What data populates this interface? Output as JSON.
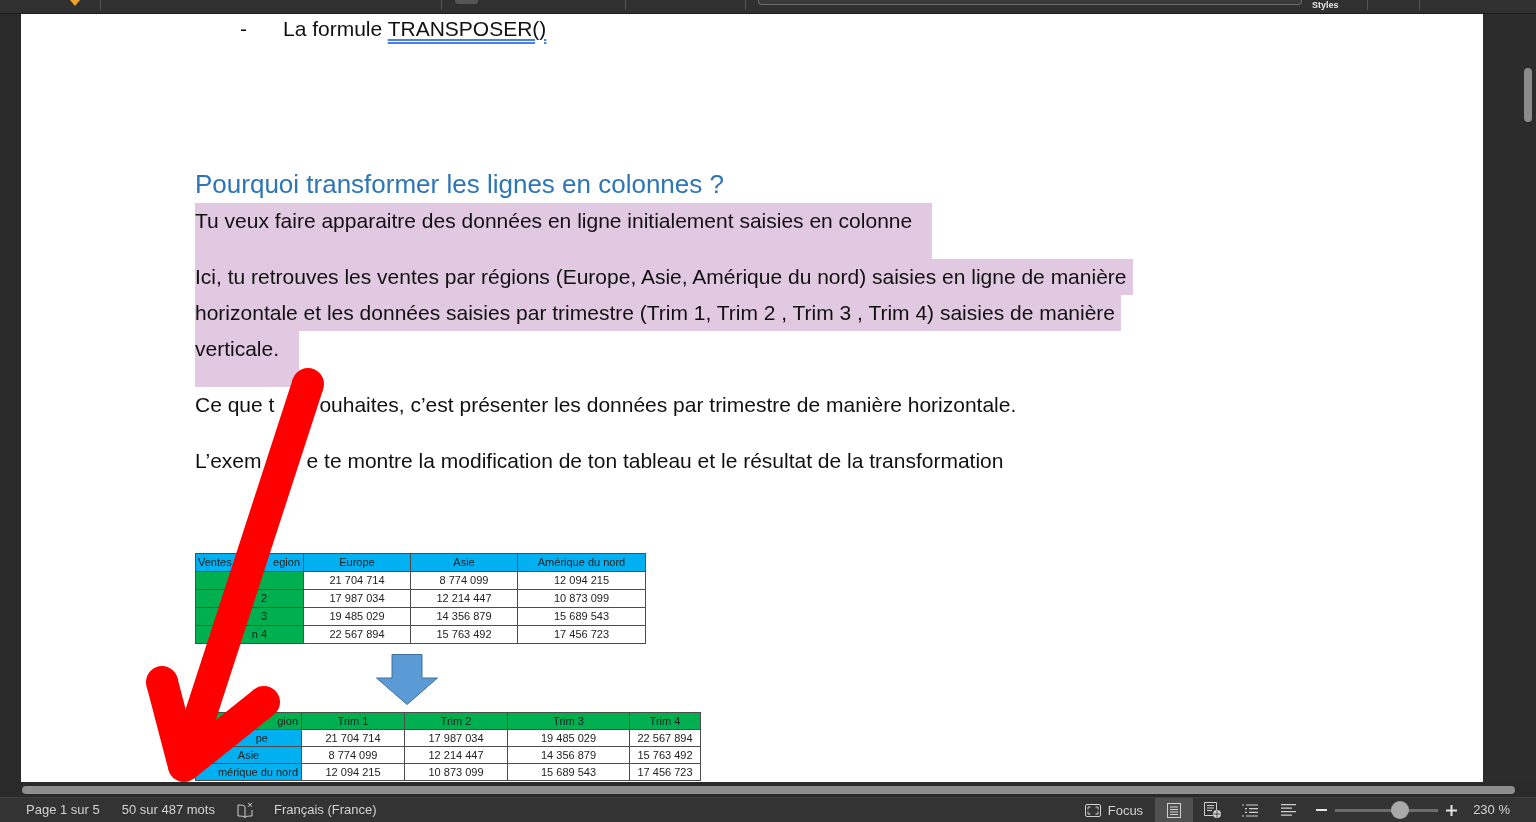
{
  "toolbar": {
    "label": "Styles"
  },
  "document": {
    "bullet_item": {
      "marker": "-",
      "text": "La formule",
      "flagged": "TRANSPOSER()"
    },
    "heading": "Pourquoi transformer les lignes en colonnes ?",
    "paragraphs": [
      {
        "kind": "lines",
        "highlighted": true,
        "lines": [
          "Tu veux faire apparaitre des données en ligne initialement saisies en colonne"
        ]
      },
      {
        "kind": "lines",
        "highlighted": true,
        "lines": [
          "Ici, tu retrouves les ventes par régions (Europe, Asie, Amérique du nord) saisies en ligne de manière",
          "horizontale et les données saisies par trimestre (Trim 1, Trim 2 , Trim 3 , Trim 4) saisies de manière",
          "verticale."
        ]
      },
      {
        "kind": "covered",
        "highlighted": false,
        "pieces": [
          "Ce que t",
          "ouhaites, c’est présenter les données par trimestre de manière horizontale."
        ]
      },
      {
        "kind": "covered",
        "highlighted": false,
        "pieces": [
          "L’exem",
          "e te montre la modification de ton tableau et le résultat de la transformation"
        ]
      }
    ],
    "source_table": {
      "corner": [
        "Ventes",
        "egion"
      ],
      "columns": [
        "Europe",
        "Asie",
        "Amérique du nord"
      ],
      "rows": [
        {
          "values": [
            "21 704 714",
            "8 774 099",
            "12 094 215"
          ]
        },
        {
          "label": "2",
          "values": [
            "17 987 034",
            "12 214 447",
            "10 873 099"
          ]
        },
        {
          "label": "3",
          "values": [
            "19 485 029",
            "14 356 879",
            "15 689 543"
          ]
        },
        {
          "label": "n 4",
          "values": [
            "22 567 894",
            "15 763 492",
            "17 456 723"
          ]
        }
      ]
    },
    "result_table": {
      "corner": [
        "gion"
      ],
      "columns": [
        "Trim 1",
        "Trim 2",
        "Trim 3",
        "Trim 4"
      ],
      "rows": [
        {
          "label": "pe",
          "values": [
            "21 704 714",
            "17 987 034",
            "19 485 029",
            "22 567 894"
          ]
        },
        {
          "label": "Asie",
          "values": [
            "8 774 099",
            "12 214 447",
            "14 356 879",
            "15 763 492"
          ]
        },
        {
          "label": "mérique du nord",
          "values": [
            "12 094 215",
            "10 873 099",
            "15 689 543",
            "17 456 723"
          ]
        }
      ]
    }
  },
  "status_bar": {
    "page": "Page 1 sur 5",
    "words": "50 sur 487 mots",
    "language": "Français (France)",
    "focus": "Focus",
    "views": [
      {
        "kind": "print",
        "selected": true
      },
      {
        "kind": "web",
        "selected": false
      },
      {
        "kind": "outline",
        "selected": false
      },
      {
        "kind": "draft",
        "selected": false
      }
    ],
    "zoom": {
      "level": 0.63,
      "reading": "230 %"
    }
  }
}
